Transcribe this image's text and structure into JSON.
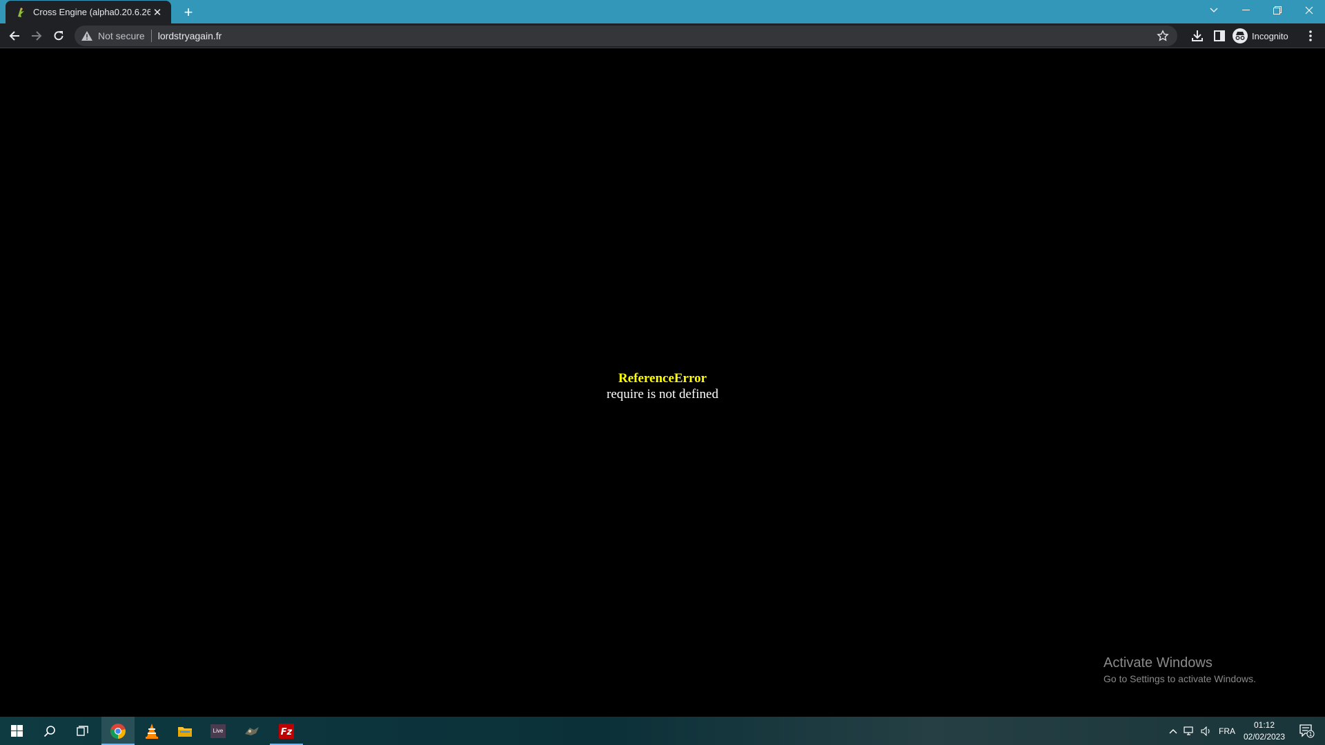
{
  "browser": {
    "tab": {
      "title": "Cross Engine (alpha0.20.6.26)",
      "favicon": "game-favicon-icon"
    },
    "address_bar": {
      "security_label": "Not secure",
      "url": "lordstryagain.fr"
    },
    "profile": {
      "label": "Incognito"
    },
    "colors": {
      "frame": "#3297b9",
      "toolbar": "#202124"
    }
  },
  "page": {
    "error": {
      "title": "ReferenceError",
      "message": "require is not defined",
      "title_color": "#ffff00",
      "message_color": "#ffffff"
    }
  },
  "watermark": {
    "title": "Activate Windows",
    "subtitle": "Go to Settings to activate Windows."
  },
  "taskbar": {
    "pinned": [
      "windows-start-icon",
      "search-icon",
      "task-view-icon",
      "chrome-icon",
      "vlc-icon",
      "file-explorer-icon",
      "live-app-icon",
      "game-app-icon",
      "filezilla-icon"
    ],
    "live_label": "Live",
    "language": "FRA",
    "time": "01:12",
    "date": "02/02/2023",
    "notification_count": "1"
  }
}
